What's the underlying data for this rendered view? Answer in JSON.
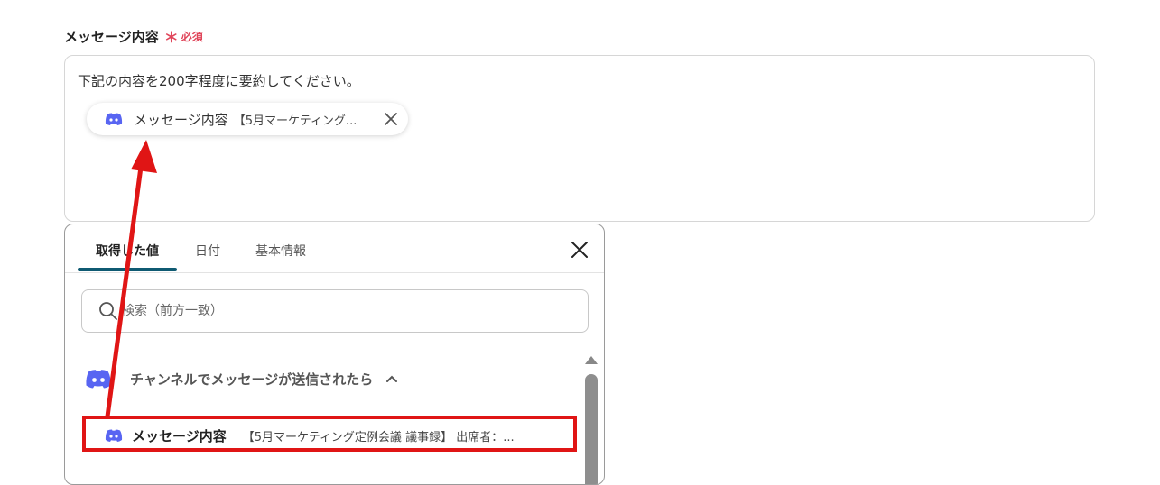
{
  "field": {
    "label": "メッセージ内容",
    "required_mark": "＊",
    "required_text": "必須"
  },
  "textarea": {
    "text": "下記の内容を200字程度に要約してください。"
  },
  "chip": {
    "label": "メッセージ内容",
    "detail": "【5月マーケティング..."
  },
  "panel": {
    "tabs": [
      {
        "label": "取得した値",
        "active": true
      },
      {
        "label": "日付",
        "active": false
      },
      {
        "label": "基本情報",
        "active": false
      }
    ],
    "search_placeholder": "検索（前方一致）",
    "group_title": "チャンネルでメッセージが送信されたら",
    "item": {
      "label": "メッセージ内容",
      "detail": "【5月マーケティング定例会議 議事録】 出席者：..."
    }
  },
  "colors": {
    "required": "#e0455a",
    "tab_underline": "#0f5a72",
    "discord": "#5865f2",
    "annotation": "#e01515"
  }
}
